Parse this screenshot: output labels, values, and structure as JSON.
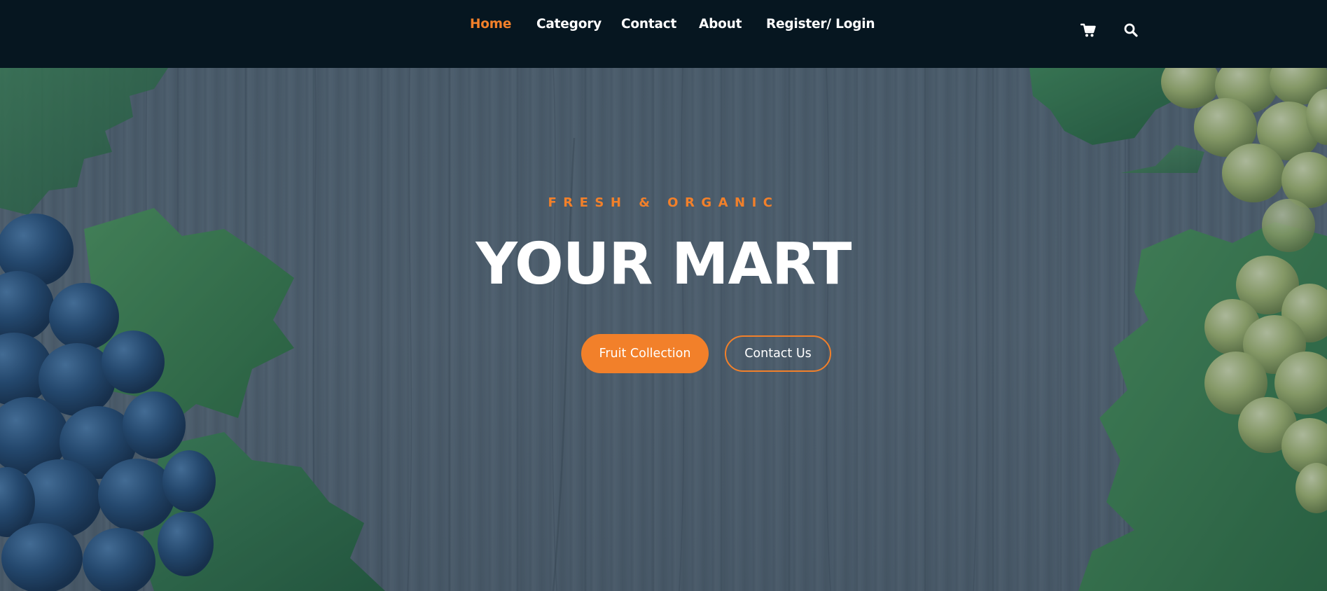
{
  "nav": {
    "items": [
      {
        "label": "Home",
        "active": true
      },
      {
        "label": "Category",
        "active": false
      },
      {
        "label": "Contact",
        "active": false
      },
      {
        "label": "About",
        "active": false
      },
      {
        "label": "Register/ Login",
        "active": false
      }
    ],
    "icons": [
      "cart-icon",
      "search-icon"
    ]
  },
  "hero": {
    "kicker": "FRESH & ORGANIC",
    "title": "YOUR MART",
    "buttons": {
      "primary_label": "Fruit Collection",
      "secondary_label": "Contact Us"
    }
  },
  "colors": {
    "accent": "#f2802a",
    "nav_background": "#061620",
    "text": "#ffffff"
  }
}
